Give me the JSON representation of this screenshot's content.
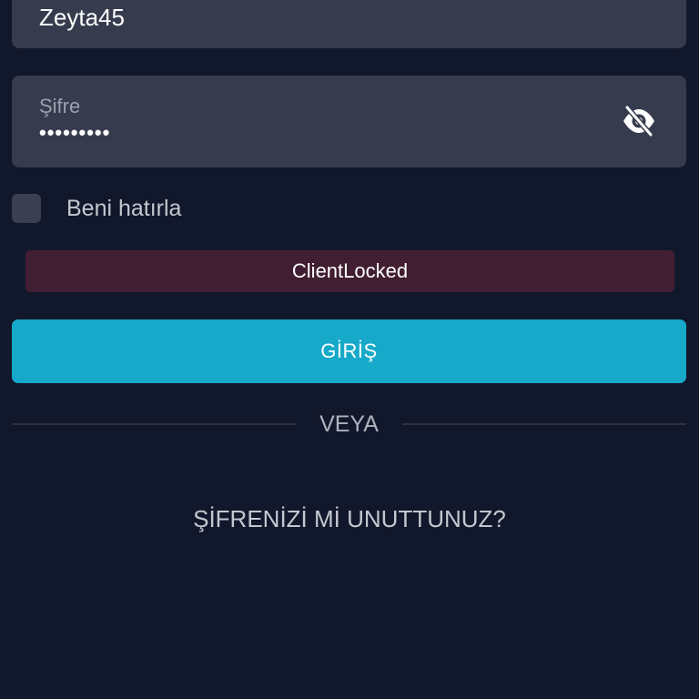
{
  "login_form": {
    "username": {
      "value": "Zeyta45"
    },
    "password": {
      "label": "Şifre",
      "masked_value": "•••••••••",
      "visibility_icon": "eye-off-icon"
    },
    "remember_me": {
      "label": "Beni hatırla",
      "checked": false
    },
    "error_message": "ClientLocked",
    "submit_label": "GİRİŞ",
    "divider_label": "VEYA",
    "forgot_password_label": "ŞİFRENİZİ Mİ UNUTTUNUZ?"
  },
  "colors": {
    "background": "#12182b",
    "field_background": "#363c4e",
    "error_background": "#411e31",
    "primary_button": "#17a9ca",
    "text_primary": "#ffffff",
    "text_secondary": "#c4c7cf",
    "text_muted": "#9aa0ad"
  }
}
